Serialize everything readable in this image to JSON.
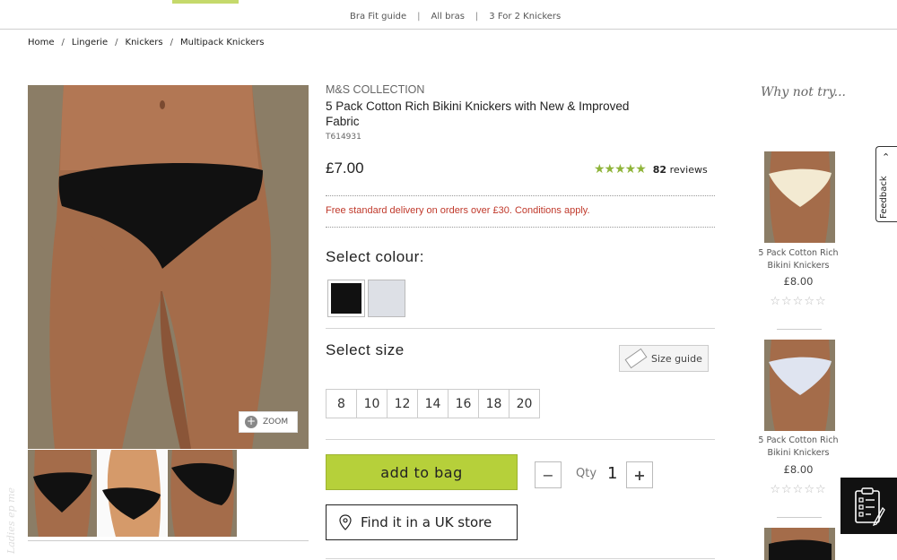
{
  "subnav": {
    "items": [
      "Bra Fit guide",
      "All bras",
      "3 For 2 Knickers"
    ]
  },
  "breadcrumb": [
    "Home",
    "Lingerie",
    "Knickers",
    "Multipack Knickers"
  ],
  "product": {
    "brand": "M&S COLLECTION",
    "title": "5 Pack Cotton Rich Bikini Knickers with New & Improved Fabric",
    "code": "T614931",
    "price": "£7.00",
    "rating": 4.5,
    "review_count": "82",
    "review_label": "reviews",
    "delivery": "Free standard delivery on orders over £30. Conditions apply.",
    "select_colour_label": "Select colour:",
    "colours": [
      {
        "name": "black",
        "hex": "#111111"
      },
      {
        "name": "white",
        "hex": "#dde0e6"
      }
    ],
    "select_size_label": "Select size",
    "size_guide_label": "Size guide",
    "sizes": [
      "8",
      "10",
      "12",
      "14",
      "16",
      "18",
      "20"
    ],
    "add_to_bag_label": "add to bag",
    "qty_label": "Qty",
    "qty_value": "1",
    "find_store_label": "Find it in a UK store",
    "zoom_label": "ZOOM"
  },
  "rail": {
    "heading": "Why not try...",
    "items": [
      {
        "name": "5 Pack Cotton Rich Bikini Knickers",
        "price": "£8.00"
      },
      {
        "name": "5 Pack Cotton Rich Bikini Knickers",
        "price": "£8.00"
      }
    ]
  },
  "feedback_label": "Feedback",
  "watermark": "Ladies ep me",
  "colors": {
    "accent_green": "#b6d03a",
    "star_green": "#8fb43a",
    "delivery_red": "#c0392b"
  }
}
